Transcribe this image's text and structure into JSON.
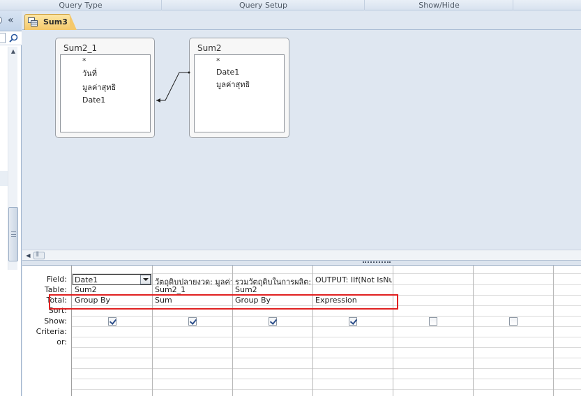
{
  "ribbon": {
    "groups": [
      "Query Type",
      "Query Setup",
      "Show/Hide"
    ]
  },
  "nav": {
    "collapse_glyph": "«"
  },
  "document_tab": {
    "label": "Sum3"
  },
  "diagram": {
    "tables": [
      {
        "name": "Sum2_1",
        "fields": [
          "*",
          "วันที่",
          "มูลค่าสุทธิ",
          "Date1"
        ]
      },
      {
        "name": "Sum2",
        "fields": [
          "*",
          "Date1",
          "มูลค่าสุทธิ"
        ]
      }
    ]
  },
  "grid": {
    "row_labels": [
      "Field:",
      "Table:",
      "Total:",
      "Sort:",
      "Show:",
      "Criteria:",
      "or:"
    ],
    "columns": [
      {
        "field": "Date1",
        "table": "Sum2",
        "total": "Group By",
        "show": true
      },
      {
        "field": "วัตถุดิบปลายงวด: มูลค่าสุ",
        "table": "Sum2_1",
        "total": "Sum",
        "show": true
      },
      {
        "field": "รวมวัตถุดิบในการผลิต: มู",
        "table": "Sum2",
        "total": "Group By",
        "show": true
      },
      {
        "field": "OUTPUT: IIf(Not IsNull",
        "table": "",
        "total": "Expression",
        "show": true
      },
      {
        "field": "",
        "table": "",
        "total": "",
        "show": false
      },
      {
        "field": "",
        "table": "",
        "total": "",
        "show": false
      }
    ]
  },
  "colors": {
    "highlight": "#e02020",
    "tab_active": "#f5c86a"
  }
}
